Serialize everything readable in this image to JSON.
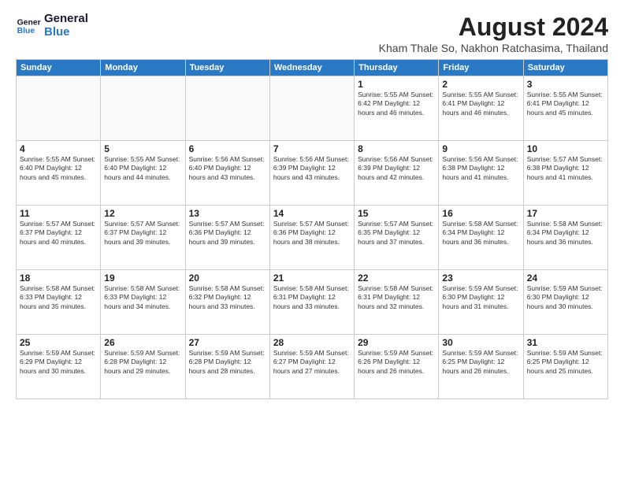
{
  "logo": {
    "line1": "General",
    "line2": "Blue"
  },
  "title": "August 2024",
  "location": "Kham Thale So, Nakhon Ratchasima, Thailand",
  "weekdays": [
    "Sunday",
    "Monday",
    "Tuesday",
    "Wednesday",
    "Thursday",
    "Friday",
    "Saturday"
  ],
  "weeks": [
    [
      {
        "day": "",
        "info": ""
      },
      {
        "day": "",
        "info": ""
      },
      {
        "day": "",
        "info": ""
      },
      {
        "day": "",
        "info": ""
      },
      {
        "day": "1",
        "info": "Sunrise: 5:55 AM\nSunset: 6:42 PM\nDaylight: 12 hours\nand 46 minutes."
      },
      {
        "day": "2",
        "info": "Sunrise: 5:55 AM\nSunset: 6:41 PM\nDaylight: 12 hours\nand 46 minutes."
      },
      {
        "day": "3",
        "info": "Sunrise: 5:55 AM\nSunset: 6:41 PM\nDaylight: 12 hours\nand 45 minutes."
      }
    ],
    [
      {
        "day": "4",
        "info": "Sunrise: 5:55 AM\nSunset: 6:40 PM\nDaylight: 12 hours\nand 45 minutes."
      },
      {
        "day": "5",
        "info": "Sunrise: 5:55 AM\nSunset: 6:40 PM\nDaylight: 12 hours\nand 44 minutes."
      },
      {
        "day": "6",
        "info": "Sunrise: 5:56 AM\nSunset: 6:40 PM\nDaylight: 12 hours\nand 43 minutes."
      },
      {
        "day": "7",
        "info": "Sunrise: 5:56 AM\nSunset: 6:39 PM\nDaylight: 12 hours\nand 43 minutes."
      },
      {
        "day": "8",
        "info": "Sunrise: 5:56 AM\nSunset: 6:39 PM\nDaylight: 12 hours\nand 42 minutes."
      },
      {
        "day": "9",
        "info": "Sunrise: 5:56 AM\nSunset: 6:38 PM\nDaylight: 12 hours\nand 41 minutes."
      },
      {
        "day": "10",
        "info": "Sunrise: 5:57 AM\nSunset: 6:38 PM\nDaylight: 12 hours\nand 41 minutes."
      }
    ],
    [
      {
        "day": "11",
        "info": "Sunrise: 5:57 AM\nSunset: 6:37 PM\nDaylight: 12 hours\nand 40 minutes."
      },
      {
        "day": "12",
        "info": "Sunrise: 5:57 AM\nSunset: 6:37 PM\nDaylight: 12 hours\nand 39 minutes."
      },
      {
        "day": "13",
        "info": "Sunrise: 5:57 AM\nSunset: 6:36 PM\nDaylight: 12 hours\nand 39 minutes."
      },
      {
        "day": "14",
        "info": "Sunrise: 5:57 AM\nSunset: 6:36 PM\nDaylight: 12 hours\nand 38 minutes."
      },
      {
        "day": "15",
        "info": "Sunrise: 5:57 AM\nSunset: 6:35 PM\nDaylight: 12 hours\nand 37 minutes."
      },
      {
        "day": "16",
        "info": "Sunrise: 5:58 AM\nSunset: 6:34 PM\nDaylight: 12 hours\nand 36 minutes."
      },
      {
        "day": "17",
        "info": "Sunrise: 5:58 AM\nSunset: 6:34 PM\nDaylight: 12 hours\nand 36 minutes."
      }
    ],
    [
      {
        "day": "18",
        "info": "Sunrise: 5:58 AM\nSunset: 6:33 PM\nDaylight: 12 hours\nand 35 minutes."
      },
      {
        "day": "19",
        "info": "Sunrise: 5:58 AM\nSunset: 6:33 PM\nDaylight: 12 hours\nand 34 minutes."
      },
      {
        "day": "20",
        "info": "Sunrise: 5:58 AM\nSunset: 6:32 PM\nDaylight: 12 hours\nand 33 minutes."
      },
      {
        "day": "21",
        "info": "Sunrise: 5:58 AM\nSunset: 6:31 PM\nDaylight: 12 hours\nand 33 minutes."
      },
      {
        "day": "22",
        "info": "Sunrise: 5:58 AM\nSunset: 6:31 PM\nDaylight: 12 hours\nand 32 minutes."
      },
      {
        "day": "23",
        "info": "Sunrise: 5:59 AM\nSunset: 6:30 PM\nDaylight: 12 hours\nand 31 minutes."
      },
      {
        "day": "24",
        "info": "Sunrise: 5:59 AM\nSunset: 6:30 PM\nDaylight: 12 hours\nand 30 minutes."
      }
    ],
    [
      {
        "day": "25",
        "info": "Sunrise: 5:59 AM\nSunset: 6:29 PM\nDaylight: 12 hours\nand 30 minutes."
      },
      {
        "day": "26",
        "info": "Sunrise: 5:59 AM\nSunset: 6:28 PM\nDaylight: 12 hours\nand 29 minutes."
      },
      {
        "day": "27",
        "info": "Sunrise: 5:59 AM\nSunset: 6:28 PM\nDaylight: 12 hours\nand 28 minutes."
      },
      {
        "day": "28",
        "info": "Sunrise: 5:59 AM\nSunset: 6:27 PM\nDaylight: 12 hours\nand 27 minutes."
      },
      {
        "day": "29",
        "info": "Sunrise: 5:59 AM\nSunset: 6:26 PM\nDaylight: 12 hours\nand 26 minutes."
      },
      {
        "day": "30",
        "info": "Sunrise: 5:59 AM\nSunset: 6:25 PM\nDaylight: 12 hours\nand 26 minutes."
      },
      {
        "day": "31",
        "info": "Sunrise: 5:59 AM\nSunset: 6:25 PM\nDaylight: 12 hours\nand 25 minutes."
      }
    ]
  ]
}
